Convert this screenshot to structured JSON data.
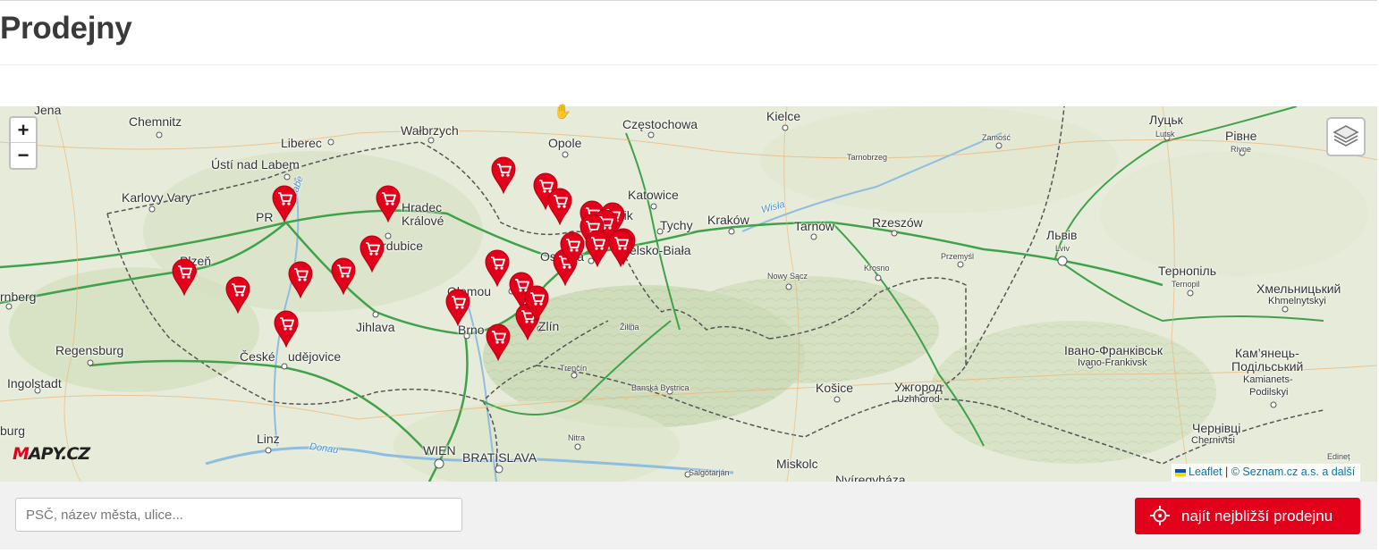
{
  "page": {
    "title": "Prodejny"
  },
  "map": {
    "zoom_in": "+",
    "zoom_out": "−",
    "logo": {
      "m": "M",
      "rest": "APY.CZ"
    },
    "attribution": {
      "leaflet": "Leaflet",
      "separator": "|",
      "provider": "© Seznam.cz a.s. a další"
    },
    "store_pin_count": 27,
    "labels": {
      "jena": "Jena",
      "chemnitz": "Chemnitz",
      "liberec": "Liberec",
      "walbrzych": "Wałbrzych",
      "czestochowa": "Częstochowa",
      "kielce": "Kielce",
      "lutsk": "Луцьк",
      "lutsk_lat": "Lutsk",
      "rivne": "Рівне",
      "rivne_lat": "Rivne",
      "zamosc": "Zamość",
      "usti": "Ústí nad Labem",
      "opole": "Opole",
      "tarnobrzeg": "Tarnobrzeg",
      "karlovy_vary": "Karlovy Vary",
      "hradec": "Hradec",
      "kralove": "Králové",
      "katowice": "Katowice",
      "rybnik": "Rybnik",
      "tychy": "Tychy",
      "krakow": "Kraków",
      "tarnow": "Tarnów",
      "rzeszow": "Rzeszów",
      "lviv": "Львів",
      "lviv_lat": "Lviv",
      "praha": "PR",
      "labe": "Labe",
      "wisla": "Wisła",
      "pardubice": "Pardubice",
      "plzen": "Plzeň",
      "ostrava": "Ostrava",
      "bielsko": "elsko-Biała",
      "przemysl": "Przemyśl",
      "nowy_sacz": "Nowy Sącz",
      "krosno": "Krosno",
      "ternopil": "Тернопіль",
      "ternopil_lat": "Ternopil",
      "nurnberg": "rnberg",
      "olomouc": "Olomou",
      "khmelnytskyi": "Хмельницький",
      "khmelnytskyi_lat": "Khmelnytskyi",
      "jihlava": "Jihlava",
      "brno": "Brno",
      "zlin": "Zlín",
      "zilina": "Žilina",
      "regensburg": "Regensburg",
      "budejovice_a": "České ",
      "budejovice_b": "udějovice",
      "ivano": "Івано-Франківськ",
      "ivano_lat": "Ivano-Frankivsk",
      "kamianets": "Кам’янець-",
      "kamianets_b": "Подільський",
      "kamianets_lat": "Kamianets-",
      "kamianets_lat_b": "Podilskyi",
      "ingolstadt": "Ingolstadt",
      "trencin": "Trenčín",
      "banska": "Banská Bystrica",
      "kosice": "Košice",
      "uzhhorod": "Ужгород",
      "uzhhorod_lat": "Uzhhorod",
      "chernivtsi": "Чернівці",
      "chernivtsi_lat": "Chernivtsi",
      "linz": "Linz",
      "donau": "Donau",
      "wien": "WIEN",
      "bratislava": "BRATISLAVA",
      "nitra": "Nitra",
      "miskolc": "Miskolc",
      "salgotarjan": "Salgótarján",
      "nyiregyhaza": "Nyíregyháza",
      "edineț": "Edineț",
      "burg": "burg"
    }
  },
  "search": {
    "placeholder": "PSČ, název města, ulice...",
    "value": ""
  },
  "find_button": {
    "label": "najít nejbližší prodejnu"
  },
  "colors": {
    "accent": "#e2001a",
    "map_bg": "#e3ead7",
    "road": "#3fa24a",
    "border": "#555555"
  }
}
